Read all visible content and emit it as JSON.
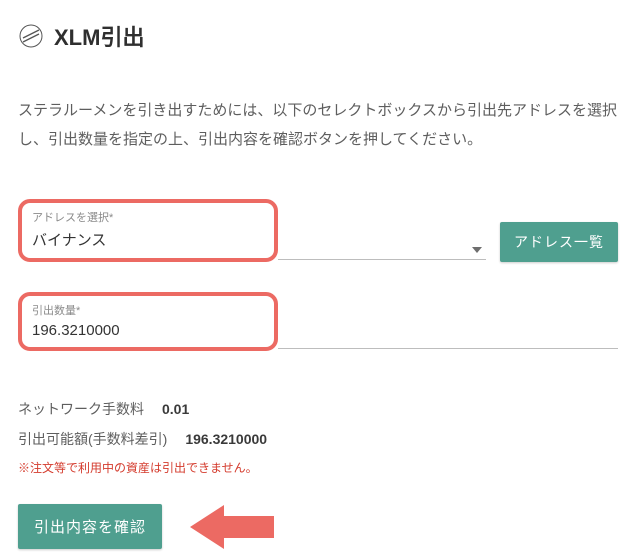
{
  "header": {
    "title": "XLM引出"
  },
  "description": "ステラルーメンを引き出すためには、以下のセレクトボックスから引出先アドレスを選択し、引出数量を指定の上、引出内容を確認ボタンを押してください。",
  "form": {
    "address": {
      "label": "アドレスを選択",
      "required_mark": "*",
      "value": "バイナンス"
    },
    "address_list_button": "アドレス一覧",
    "amount": {
      "label": "引出数量",
      "required_mark": "*",
      "value": "196.3210000"
    }
  },
  "info": {
    "fee_label": "ネットワーク手数料",
    "fee_value": "0.01",
    "withdrawable_label": "引出可能額(手数料差引)",
    "withdrawable_value": "196.3210000"
  },
  "warning": "※注文等で利用中の資産は引出できません。",
  "confirm_button": "引出内容を確認"
}
